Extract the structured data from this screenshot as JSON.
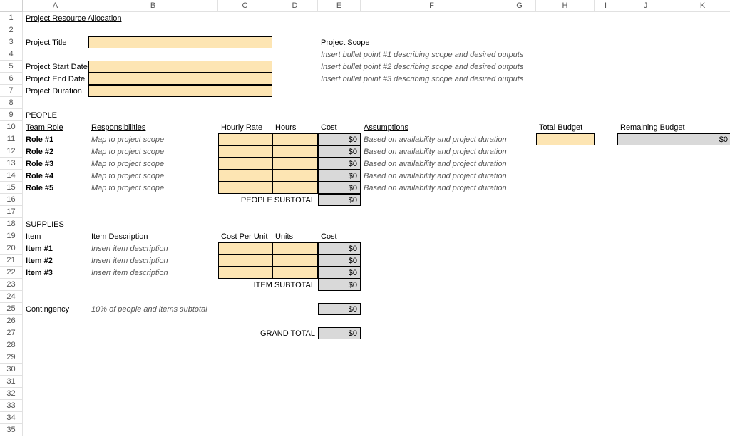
{
  "columns": [
    "A",
    "B",
    "C",
    "D",
    "E",
    "F",
    "G",
    "H",
    "I",
    "J",
    "K"
  ],
  "total_rows": 35,
  "title": "Project Resource Allocation",
  "labels": {
    "project_title": "Project Title",
    "project_start": "Project Start Date",
    "project_end": "Project End Date",
    "project_duration": "Project Duration",
    "project_scope": "Project Scope",
    "scope_bullet1": "Insert bullet point #1 describing scope and desired outputs",
    "scope_bullet2": "Insert bullet point #2 describing scope and desired outputs",
    "scope_bullet3": "Insert bullet point #3 describing scope and desired outputs",
    "people": "PEOPLE",
    "team_role": "Team Role",
    "responsibilities": "Responsibilities",
    "hourly_rate": "Hourly Rate",
    "hours": "Hours",
    "cost": "Cost",
    "assumptions": "Assumptions",
    "total_budget": "Total Budget",
    "remaining_budget": "Remaining Budget",
    "people_subtotal": "PEOPLE SUBTOTAL",
    "supplies": "SUPPLIES",
    "item": "Item",
    "item_description": "Item Description",
    "cost_per_unit": "Cost Per Unit",
    "units": "Units",
    "item_subtotal": "ITEM SUBTOTAL",
    "contingency": "Contingency",
    "contingency_desc": "10% of people and items subtotal",
    "grand_total": "GRAND TOTAL"
  },
  "roles": [
    {
      "name": "Role #1",
      "resp": "Map to project scope",
      "cost": "$0",
      "assump": "Based on availability and project duration"
    },
    {
      "name": "Role #2",
      "resp": "Map to project scope",
      "cost": "$0",
      "assump": "Based on availability and project duration"
    },
    {
      "name": "Role #3",
      "resp": "Map to project scope",
      "cost": "$0",
      "assump": "Based on availability and project duration"
    },
    {
      "name": "Role #4",
      "resp": "Map to project scope",
      "cost": "$0",
      "assump": "Based on availability and project duration"
    },
    {
      "name": "Role #5",
      "resp": "Map to project scope",
      "cost": "$0",
      "assump": "Based on availability and project duration"
    }
  ],
  "people_subtotal_value": "$0",
  "items": [
    {
      "name": "Item #1",
      "desc": "Insert item description",
      "cost": "$0"
    },
    {
      "name": "Item #2",
      "desc": "Insert item description",
      "cost": "$0"
    },
    {
      "name": "Item #3",
      "desc": "Insert item description",
      "cost": "$0"
    }
  ],
  "item_subtotal_value": "$0",
  "contingency_value": "$0",
  "grand_total_value": "$0",
  "remaining_budget_value": "$0",
  "chart_data": {
    "type": "table",
    "title": "Project Resource Allocation",
    "sections": {
      "project_info": {
        "fields": [
          "Project Title",
          "Project Start Date",
          "Project End Date",
          "Project Duration"
        ],
        "values": [
          "",
          "",
          "",
          ""
        ]
      },
      "project_scope": {
        "bullets": [
          "Insert bullet point #1 describing scope and desired outputs",
          "Insert bullet point #2 describing scope and desired outputs",
          "Insert bullet point #3 describing scope and desired outputs"
        ]
      },
      "people": {
        "columns": [
          "Team Role",
          "Responsibilities",
          "Hourly Rate",
          "Hours",
          "Cost",
          "Assumptions"
        ],
        "rows": [
          [
            "Role #1",
            "Map to project scope",
            "",
            "",
            "$0",
            "Based on availability and project duration"
          ],
          [
            "Role #2",
            "Map to project scope",
            "",
            "",
            "$0",
            "Based on availability and project duration"
          ],
          [
            "Role #3",
            "Map to project scope",
            "",
            "",
            "$0",
            "Based on availability and project duration"
          ],
          [
            "Role #4",
            "Map to project scope",
            "",
            "",
            "$0",
            "Based on availability and project duration"
          ],
          [
            "Role #5",
            "Map to project scope",
            "",
            "",
            "$0",
            "Based on availability and project duration"
          ]
        ],
        "subtotal": "$0"
      },
      "supplies": {
        "columns": [
          "Item",
          "Item Description",
          "Cost Per Unit",
          "Units",
          "Cost"
        ],
        "rows": [
          [
            "Item #1",
            "Insert item description",
            "",
            "",
            "$0"
          ],
          [
            "Item #2",
            "Insert item description",
            "",
            "",
            "$0"
          ],
          [
            "Item #3",
            "Insert item description",
            "",
            "",
            "$0"
          ]
        ],
        "subtotal": "$0"
      },
      "contingency": {
        "description": "10% of people and items subtotal",
        "value": "$0"
      },
      "grand_total": "$0",
      "total_budget": "",
      "remaining_budget": "$0"
    }
  }
}
